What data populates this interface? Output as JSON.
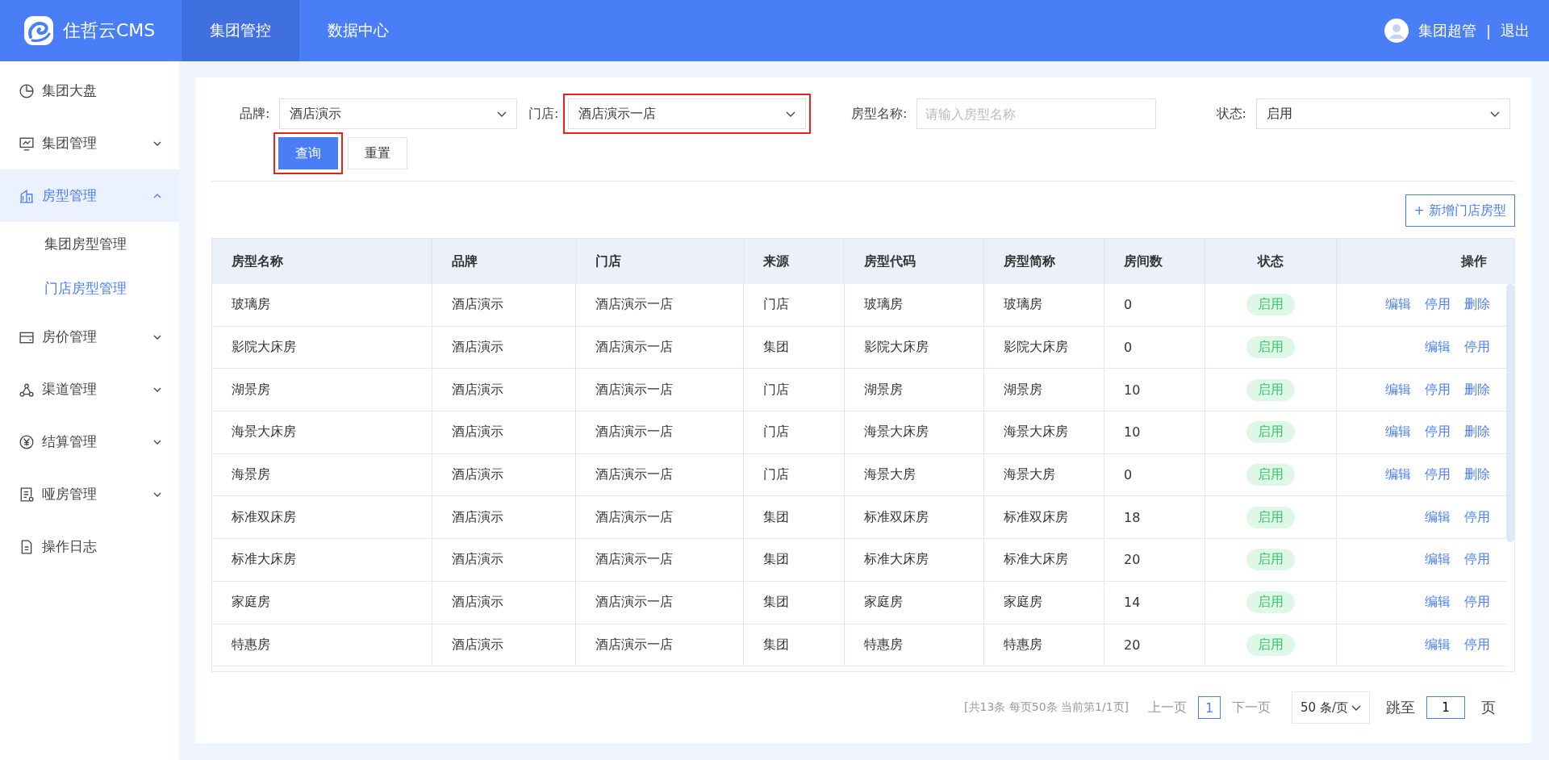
{
  "header": {
    "logo_text": "住哲云CMS",
    "nav": [
      {
        "label": "集团管控",
        "selected": true
      },
      {
        "label": "数据中心",
        "selected": false
      }
    ],
    "user": "集团超管",
    "separator": "|",
    "logout": "退出"
  },
  "sidebar": {
    "items": [
      {
        "label": "集团大盘",
        "selected": false
      },
      {
        "label": "集团管理",
        "expanded": false,
        "selected": false
      },
      {
        "label": "房型管理",
        "expanded": true,
        "selected": true,
        "children": [
          {
            "label": "集团房型管理",
            "selected": false
          },
          {
            "label": "门店房型管理",
            "selected": true
          }
        ]
      },
      {
        "label": "房价管理",
        "expanded": false,
        "selected": false
      },
      {
        "label": "渠道管理",
        "expanded": false,
        "selected": false
      },
      {
        "label": "结算管理",
        "expanded": false,
        "selected": false
      },
      {
        "label": "哑房管理",
        "expanded": false,
        "selected": false
      },
      {
        "label": "操作日志",
        "selected": false
      }
    ]
  },
  "filters": [
    {
      "label": "品牌:",
      "kind": "select",
      "value": "酒店演示",
      "highlighted": false
    },
    {
      "label": "门店:",
      "kind": "select",
      "value": "酒店演示一店",
      "highlighted": true
    },
    {
      "label": "房型名称:",
      "kind": "input",
      "placeholder": "请输入房型名称",
      "highlighted": false
    },
    {
      "label": "状态:",
      "kind": "select",
      "value": "启用",
      "highlighted": false
    }
  ],
  "actions": [
    {
      "label": "查询",
      "kind": "primary",
      "highlighted": true
    },
    {
      "label": "重置",
      "kind": "default",
      "highlighted": false
    }
  ],
  "add_button": "+ 新增门店房型",
  "table": {
    "columns": [
      "房型名称",
      "品牌",
      "门店",
      "来源",
      "房型代码",
      "房型简称",
      "房间数",
      "状态",
      "操作"
    ],
    "rows": [
      {
        "cells": [
          "玻璃房",
          "酒店演示",
          "酒店演示一店",
          "门店",
          "玻璃房",
          "玻璃房",
          "0"
        ],
        "status": "启用",
        "operations": [
          "编辑",
          "停用",
          "删除"
        ]
      },
      {
        "cells": [
          "影院大床房",
          "酒店演示",
          "酒店演示一店",
          "集团",
          "影院大床房",
          "影院大床房",
          "0"
        ],
        "status": "启用",
        "operations": [
          "编辑",
          "停用"
        ]
      },
      {
        "cells": [
          "湖景房",
          "酒店演示",
          "酒店演示一店",
          "门店",
          "湖景房",
          "湖景房",
          "10"
        ],
        "status": "启用",
        "operations": [
          "编辑",
          "停用",
          "删除"
        ]
      },
      {
        "cells": [
          "海景大床房",
          "酒店演示",
          "酒店演示一店",
          "门店",
          "海景大床房",
          "海景大床房",
          "10"
        ],
        "status": "启用",
        "operations": [
          "编辑",
          "停用",
          "删除"
        ]
      },
      {
        "cells": [
          "海景房",
          "酒店演示",
          "酒店演示一店",
          "门店",
          "海景大房",
          "海景大房",
          "0"
        ],
        "status": "启用",
        "operations": [
          "编辑",
          "停用",
          "删除"
        ]
      },
      {
        "cells": [
          "标准双床房",
          "酒店演示",
          "酒店演示一店",
          "集团",
          "标准双床房",
          "标准双床房",
          "18"
        ],
        "status": "启用",
        "operations": [
          "编辑",
          "停用"
        ]
      },
      {
        "cells": [
          "标准大床房",
          "酒店演示",
          "酒店演示一店",
          "集团",
          "标准大床房",
          "标准大床房",
          "20"
        ],
        "status": "启用",
        "operations": [
          "编辑",
          "停用"
        ]
      },
      {
        "cells": [
          "家庭房",
          "酒店演示",
          "酒店演示一店",
          "集团",
          "家庭房",
          "家庭房",
          "14"
        ],
        "status": "启用",
        "operations": [
          "编辑",
          "停用"
        ]
      },
      {
        "cells": [
          "特惠房",
          "酒店演示",
          "酒店演示一店",
          "集团",
          "特惠房",
          "特惠房",
          "20"
        ],
        "status": "启用",
        "operations": [
          "编辑",
          "停用"
        ]
      }
    ]
  },
  "pagination": {
    "summary": "[共13条 每页50条 当前第1/1页]",
    "prev": "上一页",
    "pages": [
      {
        "label": "1",
        "selected": true
      }
    ],
    "next": "下一页",
    "page_size": "50 条/页",
    "jump_label": "跳至",
    "jump_value": "1",
    "page_unit": "页"
  }
}
